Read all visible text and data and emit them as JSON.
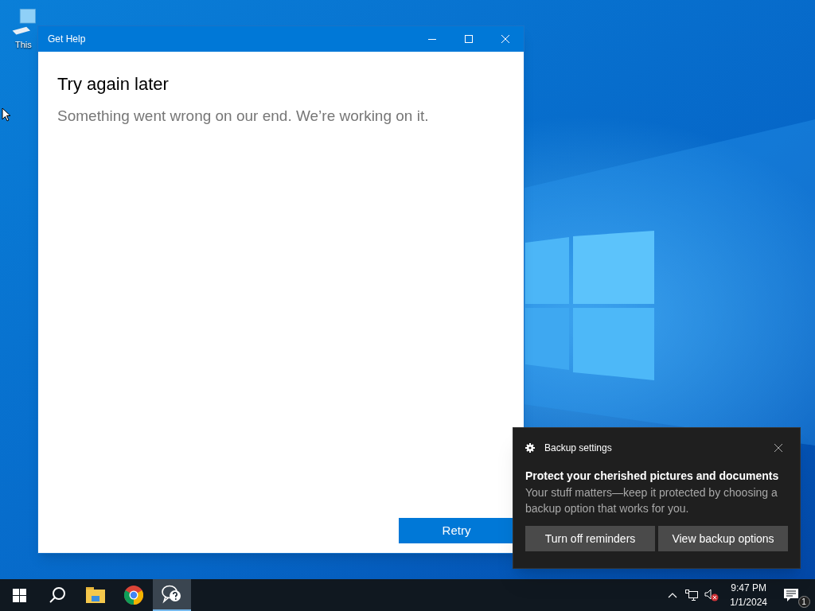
{
  "desktop": {
    "icons": [
      {
        "label": "This"
      }
    ]
  },
  "window": {
    "title": "Get Help",
    "heading": "Try again later",
    "message": "Something went wrong on our end. We’re working on it.",
    "button": "Retry"
  },
  "toast": {
    "app": "Backup settings",
    "title": "Protect your cherished pictures and documents",
    "body": "Your stuff matters—keep it protected by choosing a backup option that works for you.",
    "buttons": [
      "Turn off reminders",
      "View backup options"
    ]
  },
  "taskbar": {
    "items": [
      {
        "kind": "start",
        "selected": false
      },
      {
        "kind": "search",
        "selected": false
      },
      {
        "kind": "folder",
        "selected": false
      },
      {
        "kind": "browser",
        "selected": false
      },
      {
        "kind": "help",
        "selected": true
      }
    ],
    "clock": {
      "time": "9:47 PM",
      "date": "1/1/2024"
    },
    "notification_count": "1"
  }
}
